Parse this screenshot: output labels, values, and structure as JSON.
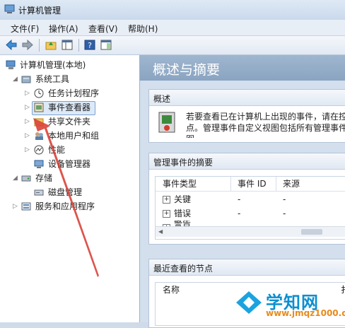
{
  "window": {
    "title": "计算机管理"
  },
  "menu": [
    "文件(F)",
    "操作(A)",
    "查看(V)",
    "帮助(H)"
  ],
  "toolbar": {
    "buttons": [
      "back-icon",
      "forward-icon",
      "up-folder-icon",
      "show-hide-tree-icon",
      "help-icon",
      "action-pane-icon"
    ]
  },
  "tree": {
    "root": "计算机管理(本地)",
    "system_tools": "系统工具",
    "task_scheduler": "任务计划程序",
    "event_viewer": "事件查看器",
    "shared_folders": "共享文件夹",
    "local_users": "本地用户和组",
    "performance": "性能",
    "device_manager": "设备管理器",
    "storage": "存储",
    "disk_management": "磁盘管理",
    "services_apps": "服务和应用程序"
  },
  "main": {
    "header": "概述与摘要",
    "overview": {
      "title": "概述",
      "line1": "若要查看已在计算机上出现的事件，请在控",
      "line2": "点。管理事件自定义视图包括所有管理事件",
      "line3": "图"
    },
    "summary": {
      "title": "管理事件的摘要",
      "columns": [
        "事件类型",
        "事件 ID",
        "来源"
      ],
      "rows": [
        {
          "type": "关键",
          "id": "-",
          "source": "-"
        },
        {
          "type": "错误",
          "id": "-",
          "source": "-"
        },
        {
          "type": "警告",
          "id": "",
          "source": ""
        }
      ]
    },
    "recent": {
      "title": "最近查看的节点",
      "columns": [
        "名称",
        "扌"
      ]
    }
  },
  "watermark": {
    "title": "学知网",
    "url": "www.jmqz1000.com"
  },
  "colors": {
    "accent": "#2a6db8",
    "arrow": "#d9433a"
  }
}
